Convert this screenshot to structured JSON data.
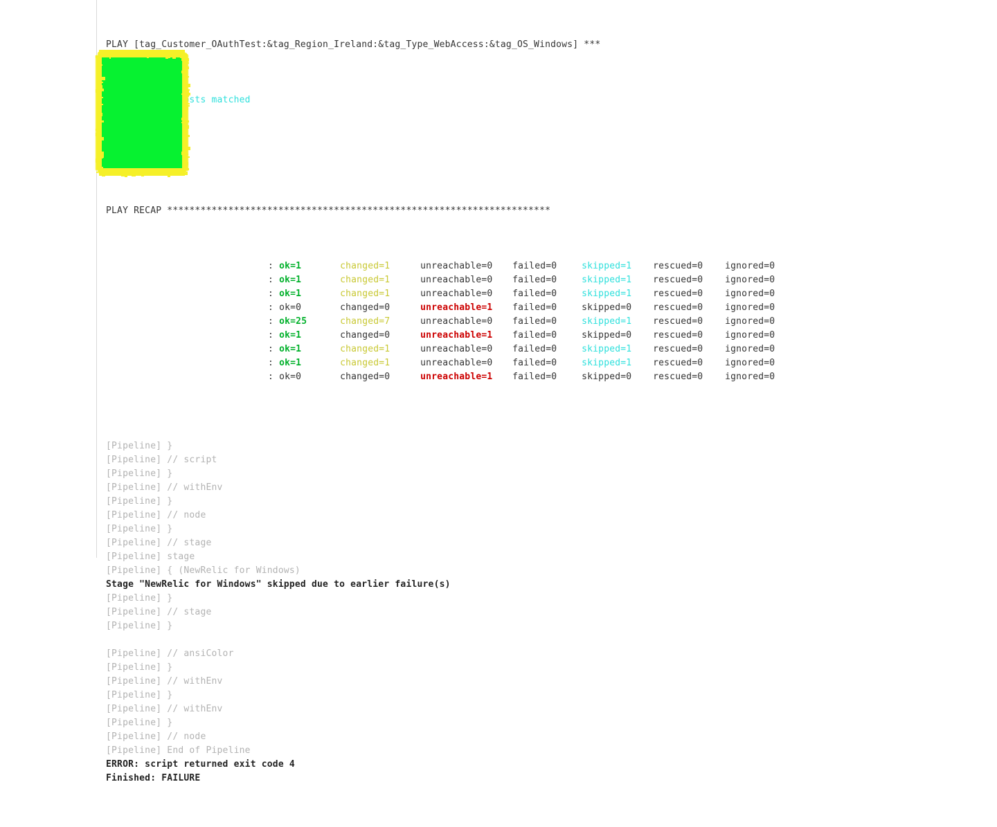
{
  "page": {
    "background": "#ffffff",
    "rule_color": "#d9d9d9"
  },
  "colors": {
    "default_text": "#333333",
    "cyan": "#2ee0dc",
    "green": "#00b02a",
    "yellow": "#c8c832",
    "red": "#cc0000",
    "grey": "#b2b2b2",
    "bold_black": "#222222",
    "redaction_fill": "#06f230",
    "redaction_edge": "#f5f028"
  },
  "log": {
    "play_header": "PLAY [tag_Customer_OAuthTest:&tag_Region_Ireland:&tag_Type_WebAccess:&tag_OS_Windows] ***",
    "skipping": "skipping: no hosts matched",
    "recap_header": "PLAY RECAP *********************************************************************",
    "recap_separator": " : ",
    "recap_rows": [
      {
        "host": "",
        "ok": "ok=1",
        "changed": "changed=1",
        "unreachable": "unreachable=0",
        "failed": "failed=0",
        "skipped": "skipped=1",
        "rescued": "rescued=0",
        "ignored": "ignored=0",
        "ok_color": "green",
        "changed_color": "yellow",
        "unreachable_color": "default",
        "skipped_color": "cyan"
      },
      {
        "host": "",
        "ok": "ok=1",
        "changed": "changed=1",
        "unreachable": "unreachable=0",
        "failed": "failed=0",
        "skipped": "skipped=1",
        "rescued": "rescued=0",
        "ignored": "ignored=0",
        "ok_color": "green",
        "changed_color": "yellow",
        "unreachable_color": "default",
        "skipped_color": "cyan"
      },
      {
        "host": "",
        "ok": "ok=1",
        "changed": "changed=1",
        "unreachable": "unreachable=0",
        "failed": "failed=0",
        "skipped": "skipped=1",
        "rescued": "rescued=0",
        "ignored": "ignored=0",
        "ok_color": "green",
        "changed_color": "yellow",
        "unreachable_color": "default",
        "skipped_color": "cyan"
      },
      {
        "host": "",
        "ok": "ok=0",
        "changed": "changed=0",
        "unreachable": "unreachable=1",
        "failed": "failed=0",
        "skipped": "skipped=0",
        "rescued": "rescued=0",
        "ignored": "ignored=0",
        "ok_color": "default",
        "changed_color": "default",
        "unreachable_color": "red",
        "skipped_color": "default"
      },
      {
        "host": "",
        "ok": "ok=25",
        "changed": "changed=7",
        "unreachable": "unreachable=0",
        "failed": "failed=0",
        "skipped": "skipped=1",
        "rescued": "rescued=0",
        "ignored": "ignored=0",
        "ok_color": "green",
        "changed_color": "yellow",
        "unreachable_color": "default",
        "skipped_color": "cyan"
      },
      {
        "host": "",
        "ok": "ok=1",
        "changed": "changed=0",
        "unreachable": "unreachable=1",
        "failed": "failed=0",
        "skipped": "skipped=0",
        "rescued": "rescued=0",
        "ignored": "ignored=0",
        "ok_color": "green",
        "changed_color": "default",
        "unreachable_color": "red",
        "skipped_color": "default"
      },
      {
        "host": "",
        "ok": "ok=1",
        "changed": "changed=1",
        "unreachable": "unreachable=0",
        "failed": "failed=0",
        "skipped": "skipped=1",
        "rescued": "rescued=0",
        "ignored": "ignored=0",
        "ok_color": "green",
        "changed_color": "yellow",
        "unreachable_color": "default",
        "skipped_color": "cyan"
      },
      {
        "host": "",
        "ok": "ok=1",
        "changed": "changed=1",
        "unreachable": "unreachable=0",
        "failed": "failed=0",
        "skipped": "skipped=1",
        "rescued": "rescued=0",
        "ignored": "ignored=0",
        "ok_color": "green",
        "changed_color": "yellow",
        "unreachable_color": "default",
        "skipped_color": "cyan"
      },
      {
        "host": "",
        "ok": "ok=0",
        "changed": "changed=0",
        "unreachable": "unreachable=1",
        "failed": "failed=0",
        "skipped": "skipped=0",
        "rescued": "rescued=0",
        "ignored": "ignored=0",
        "ok_color": "default",
        "changed_color": "default",
        "unreachable_color": "red",
        "skipped_color": "default"
      }
    ],
    "tail_lines": [
      {
        "text": "",
        "color": "default"
      },
      {
        "text": "[Pipeline] }",
        "color": "grey"
      },
      {
        "text": "[Pipeline] // script",
        "color": "grey"
      },
      {
        "text": "[Pipeline] }",
        "color": "grey"
      },
      {
        "text": "[Pipeline] // withEnv",
        "color": "grey"
      },
      {
        "text": "[Pipeline] }",
        "color": "grey"
      },
      {
        "text": "[Pipeline] // node",
        "color": "grey"
      },
      {
        "text": "[Pipeline] }",
        "color": "grey"
      },
      {
        "text": "[Pipeline] // stage",
        "color": "grey"
      },
      {
        "text": "[Pipeline] stage",
        "color": "grey"
      },
      {
        "text": "[Pipeline] { (NewRelic for Windows)",
        "color": "grey"
      },
      {
        "text": "Stage \"NewRelic for Windows\" skipped due to earlier failure(s)",
        "color": "bold"
      },
      {
        "text": "[Pipeline] }",
        "color": "grey"
      },
      {
        "text": "[Pipeline] // stage",
        "color": "grey"
      },
      {
        "text": "[Pipeline] }",
        "color": "grey"
      },
      {
        "text": "",
        "color": "default"
      },
      {
        "text": "[Pipeline] // ansiColor",
        "color": "grey"
      },
      {
        "text": "[Pipeline] }",
        "color": "grey"
      },
      {
        "text": "[Pipeline] // withEnv",
        "color": "grey"
      },
      {
        "text": "[Pipeline] }",
        "color": "grey"
      },
      {
        "text": "[Pipeline] // withEnv",
        "color": "grey"
      },
      {
        "text": "[Pipeline] }",
        "color": "grey"
      },
      {
        "text": "[Pipeline] // node",
        "color": "grey"
      },
      {
        "text": "[Pipeline] End of Pipeline",
        "color": "grey"
      },
      {
        "text": "ERROR: script returned exit code 4",
        "color": "bold"
      },
      {
        "text": "Finished: FAILURE",
        "color": "bold"
      }
    ]
  },
  "redaction": {
    "label": "redacted-host-names"
  }
}
